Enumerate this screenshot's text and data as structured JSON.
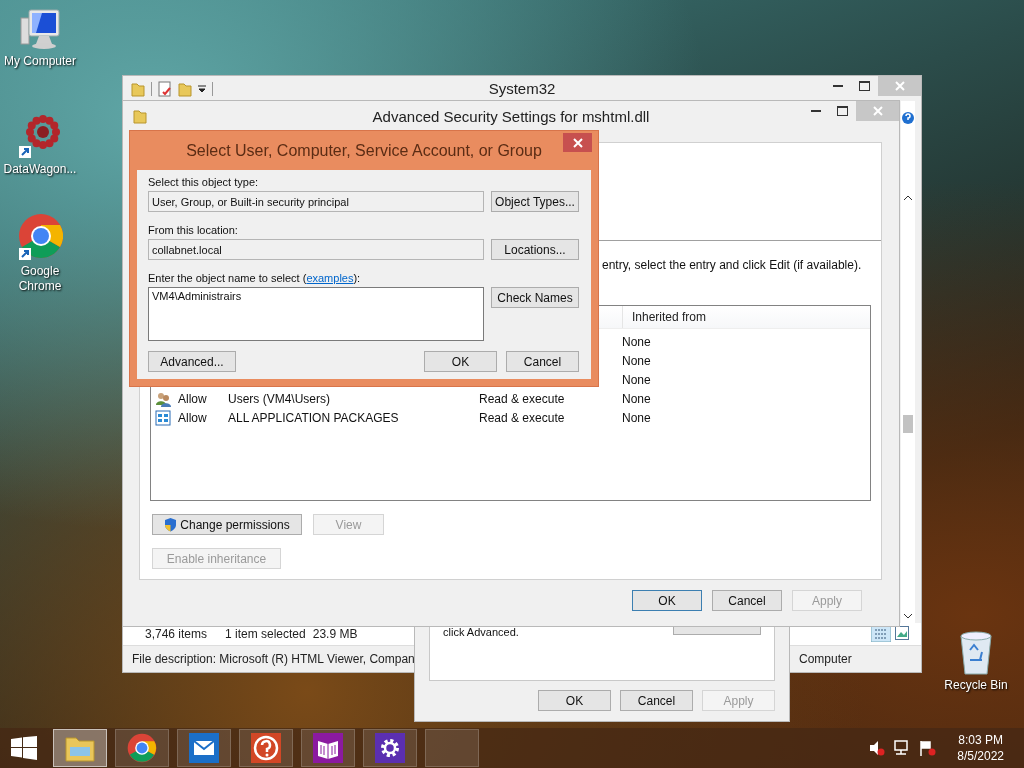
{
  "desktop_icons": [
    {
      "kind": "computer",
      "label": "My Computer"
    },
    {
      "kind": "app",
      "label": "DataWagon..."
    },
    {
      "kind": "chrome",
      "label": "Google Chrome"
    },
    {
      "kind": "recycle",
      "label": "Recycle Bin"
    }
  ],
  "explorer": {
    "title": "System32",
    "status_bar": {
      "item_count": "3,746 items",
      "selection": "1 item selected",
      "size": "23.9 MB"
    },
    "details": {
      "description": "File description: Microsoft (R) HTML Viewer, Compan",
      "column_2": "Computer"
    }
  },
  "properties": {
    "text": "click Advanced.",
    "buttons": [
      {
        "label": "OK",
        "disabled": false
      },
      {
        "label": "Cancel",
        "disabled": false
      },
      {
        "label": "Apply",
        "disabled": true
      }
    ]
  },
  "advanced_security": {
    "title": "Advanced Security Settings for mshtml.dll",
    "instruction": "entry, select the entry and click Edit (if available).",
    "table": {
      "columns": [
        "Inherited from"
      ],
      "rows": [
        {
          "inherited_from": "None"
        },
        {
          "inherited_from": "None"
        },
        {
          "inherited_from": "None"
        },
        {
          "kind": "users",
          "type": "Allow",
          "principal": "Users (VM4\\Users)",
          "access": "Read & execute",
          "inherited_from": "None"
        },
        {
          "kind": "packages",
          "type": "Allow",
          "principal": "ALL APPLICATION PACKAGES",
          "access": "Read & execute",
          "inherited_from": "None"
        }
      ]
    },
    "buttons": [
      {
        "label": "Change permissions",
        "kind": "shield",
        "disabled": false
      },
      {
        "label": "View",
        "kind": "plain",
        "disabled": true
      }
    ],
    "inheritance_button": {
      "label": "Enable inheritance",
      "disabled": true
    },
    "footer_buttons": [
      {
        "label": "OK",
        "default": true,
        "disabled": false
      },
      {
        "label": "Cancel",
        "default": false,
        "disabled": false
      },
      {
        "label": "Apply",
        "default": false,
        "disabled": true
      }
    ]
  },
  "select_dialog": {
    "title": "Select User, Computer, Service Account, or Group",
    "object_type": {
      "label": "Select this object type:",
      "value": "User, Group, or Built-in security principal",
      "button": "Object Types..."
    },
    "location": {
      "label": "From this location:",
      "value": "collabnet.local",
      "button": "Locations..."
    },
    "object_name": {
      "label": "Enter the object name to select (",
      "link": "examples",
      "label_end": "):",
      "value": "VM4\\Administrairs",
      "button": "Check Names"
    },
    "buttons": [
      "Advanced...",
      "OK",
      "Cancel"
    ]
  },
  "taskbar": {
    "items": [
      {
        "kind": "explorer",
        "selected": true
      },
      {
        "kind": "chrome",
        "selected": false
      },
      {
        "kind": "mail",
        "selected": false
      },
      {
        "kind": "help",
        "selected": false
      },
      {
        "kind": "reader",
        "selected": false
      },
      {
        "kind": "settings",
        "selected": false
      },
      {
        "kind": "empty",
        "selected": false
      }
    ],
    "clock": {
      "time": "8:03 PM",
      "date": "8/5/2022"
    }
  }
}
